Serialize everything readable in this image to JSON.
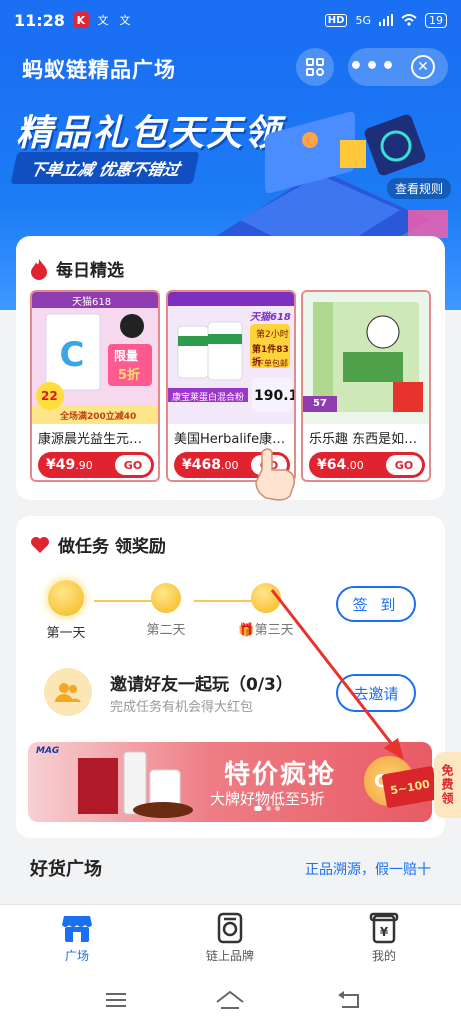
{
  "status_bar": {
    "time": "11:28",
    "app_icons": [
      "K",
      "K",
      "文",
      "文"
    ],
    "hd": "HD",
    "network": "5G",
    "battery": "19"
  },
  "header": {
    "title": "蚂蚁链精品广场",
    "more_label": "•••"
  },
  "banner": {
    "headline": "精品礼包天天领",
    "subline": "下单立减 优惠不错过",
    "rules_link": "查看规则"
  },
  "daily": {
    "title": "每日精选",
    "products": [
      {
        "name": "康源晨光益生元…",
        "currency": "¥",
        "price": "49",
        "price_decimal": ".90",
        "go": "GO"
      },
      {
        "name": "美国Herbalife康…",
        "currency": "¥",
        "price": "468",
        "price_decimal": ".00",
        "go": "GO"
      },
      {
        "name": "乐乐趣 东西是如…",
        "currency": "¥",
        "price": "64",
        "price_decimal": ".00",
        "go": "GO"
      }
    ],
    "badges": {
      "p1_tag": "天猫618",
      "p1_discount": "限量",
      "p1_discount2": "5折",
      "p1_percent": "22",
      "p1_coupon": "全场满200立减40",
      "p2_tag": "天猫618",
      "p2_badge1": "第2小时",
      "p2_badge2": "第1件83折",
      "p2_badge3": "下单包邮",
      "p2_mix": "康宝莱蛋白混合粉",
      "p2_price": "190.1",
      "p3_price": "57"
    }
  },
  "tasks": {
    "title": "做任务 领奖励",
    "steps": [
      "第一天",
      "第二天",
      "第三天"
    ],
    "signin_label": "签 到",
    "invite_title": "邀请好友一起玩（0/3）",
    "invite_sub": "完成任务有机会得大红包",
    "invite_button": "去邀请"
  },
  "promo": {
    "logo": "MAG",
    "title": "特价疯抢",
    "subtitle": "大牌好物低至5折",
    "go": "GO"
  },
  "float_coupon": {
    "amount": "5~100",
    "side_text": "免费领"
  },
  "section": {
    "title": "好货广场",
    "subtitle": "正品溯源，假一赔十"
  },
  "tabbar": {
    "items": [
      {
        "label": "广场",
        "icon": "store-icon"
      },
      {
        "label": "链上品牌",
        "icon": "brand-icon"
      },
      {
        "label": "我的",
        "icon": "profile-icon"
      }
    ]
  },
  "colors": {
    "primary": "#1a6ff2",
    "price_red": "#e0232e",
    "annotation_red": "#e8322c"
  }
}
